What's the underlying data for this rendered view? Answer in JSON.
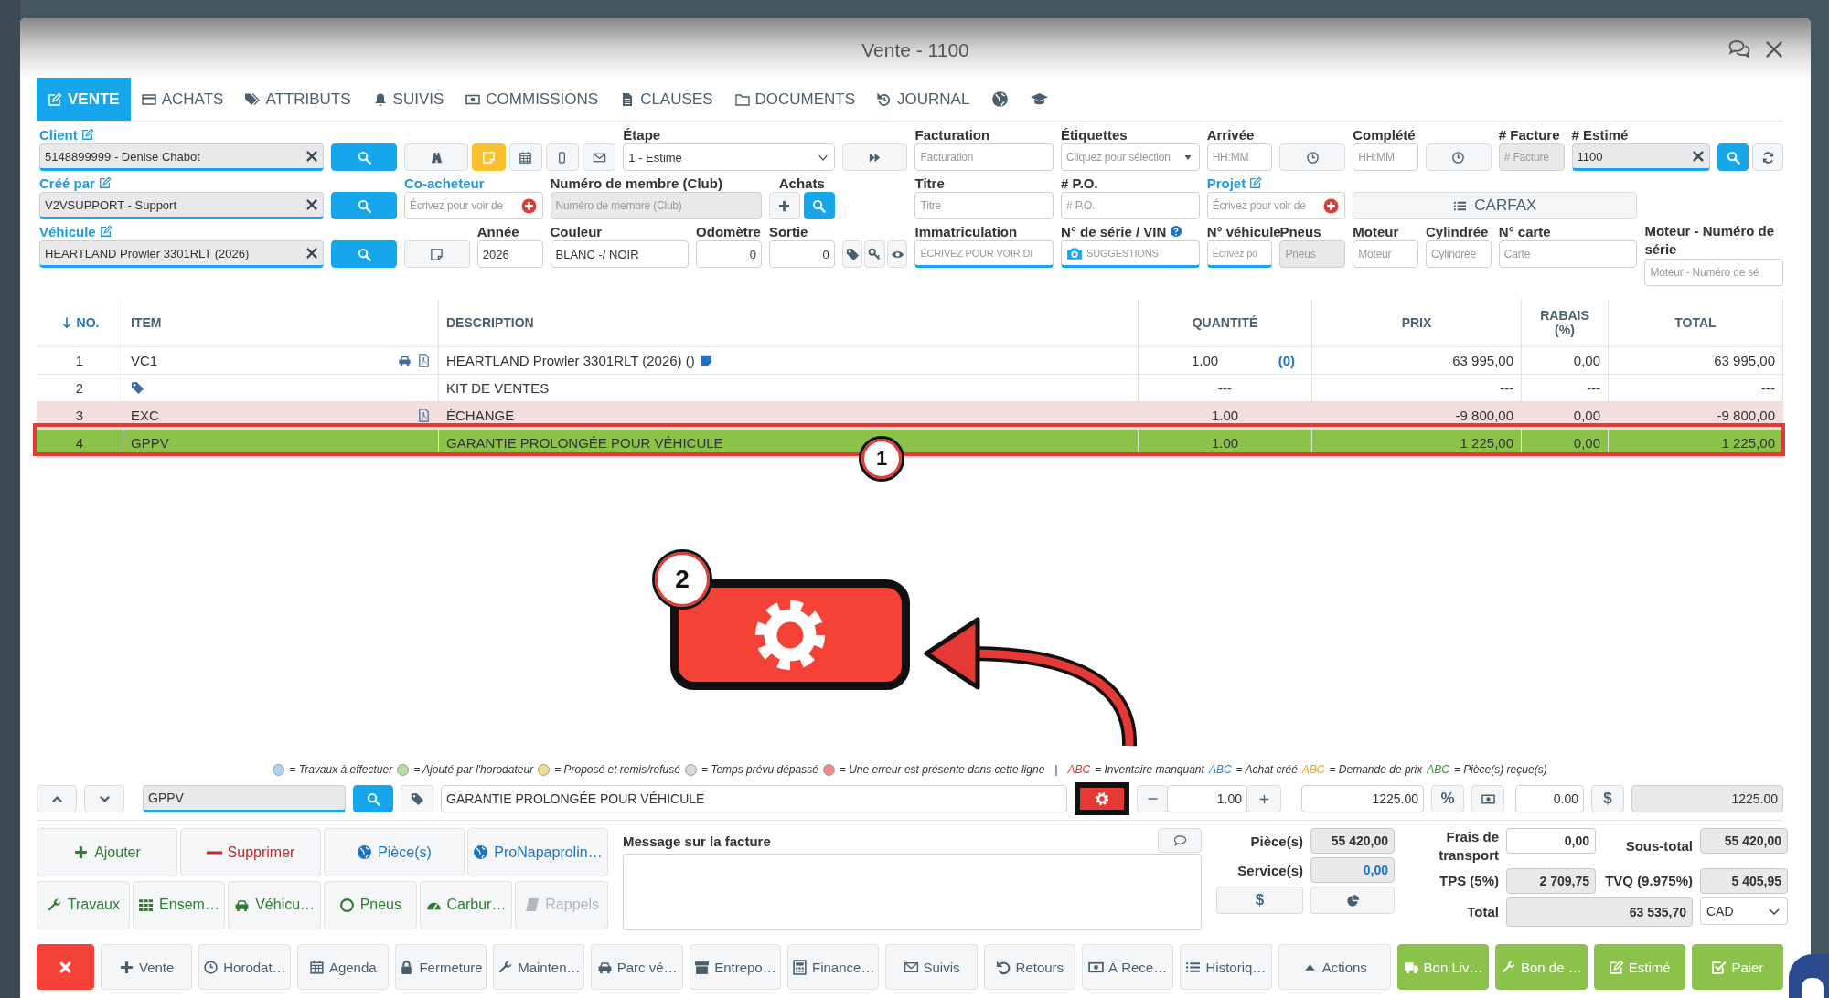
{
  "window": {
    "title": "Vente - 1100"
  },
  "tabs": [
    {
      "label": "VENTE",
      "selected": true
    },
    {
      "label": "ACHATS",
      "selected": false
    },
    {
      "label": "ATTRIBUTS",
      "selected": false
    },
    {
      "label": "SUIVIS",
      "selected": false
    },
    {
      "label": "COMMISSIONS",
      "selected": false
    },
    {
      "label": "CLAUSES",
      "selected": false
    },
    {
      "label": "DOCUMENTS",
      "selected": false
    },
    {
      "label": "JOURNAL",
      "selected": false
    }
  ],
  "form": {
    "fields": [
      {
        "kind": "lookup",
        "label": "Client",
        "link": true,
        "edit_icon": true,
        "value": "5148899999 - Denise Chabot"
      },
      {
        "kind": "search"
      },
      {
        "kind": "tools",
        "note": true
      },
      {
        "kind": "select",
        "label": "Étape",
        "link": false,
        "value": "1 - Estimé"
      },
      {
        "kind": "forward"
      },
      {
        "kind": "input",
        "label": "Facturation",
        "link": false,
        "placeholder": "Facturation"
      },
      {
        "kind": "select",
        "label": "Étiquettes",
        "link": false,
        "placeholder": "Cliquez pour sélection"
      },
      {
        "kind": "input",
        "label": "Arrivée",
        "link": false,
        "placeholder": "HH:MM"
      },
      {
        "kind": "clock"
      },
      {
        "kind": "input",
        "label": "Complété",
        "link": false,
        "placeholder": "HH:MM"
      },
      {
        "kind": "clock"
      },
      {
        "kind": "readonly",
        "label": "# Facture",
        "link": false,
        "placeholder": "# Facture"
      },
      {
        "kind": "lookup",
        "label": "# Estimé",
        "link": false,
        "value": "1100"
      },
      {
        "kind": "search-refresh"
      },
      {
        "kind": "lookup",
        "label": "Créé par",
        "link": true,
        "edit_icon": true,
        "value": "V2VSUPPORT - Support"
      },
      {
        "kind": "search"
      },
      {
        "kind": "add",
        "label": "Co-acheteur",
        "link": true,
        "placeholder": "Écrivez pour voir de"
      },
      {
        "kind": "readonly",
        "label": "Numéro de membre (Club)",
        "link": false,
        "placeholder": "Numéro de membre (Club)"
      },
      {
        "kind": "plus-search",
        "label": "Achats",
        "link": false
      },
      {
        "kind": "blank"
      },
      {
        "kind": "input",
        "label": "Titre",
        "link": false,
        "placeholder": "Titre"
      },
      {
        "kind": "input",
        "label": "# P.O.",
        "link": false,
        "placeholder": "# P.O."
      },
      {
        "kind": "add",
        "label": "Projet",
        "link": true,
        "edit_icon": true,
        "placeholder": "Écrivez pour voir de"
      },
      {
        "kind": "carfax",
        "text": "CARFAX"
      },
      {
        "kind": "blank"
      },
      {
        "kind": "lookup",
        "label": "Véhicule",
        "link": true,
        "edit_icon": true,
        "value": "HEARTLAND Prowler 3301RLT (2026)"
      },
      {
        "kind": "search"
      },
      {
        "kind": "note"
      },
      {
        "kind": "input",
        "label": "Année",
        "link": false,
        "value": "2026"
      },
      {
        "kind": "input",
        "label": "Couleur",
        "link": false,
        "value": "BLANC -/ NOIR"
      },
      {
        "kind": "number",
        "label": "Odomètre",
        "link": false,
        "value": "0"
      },
      {
        "kind": "number",
        "label": "Sortie",
        "link": false,
        "value": "0"
      },
      {
        "kind": "tags"
      },
      {
        "kind": "autocomplete",
        "label": "Immatriculation",
        "link": false,
        "placeholder": "ÉCRIVEZ POUR VOIR DI"
      },
      {
        "kind": "vin",
        "label": "N° de série / VIN",
        "link": false,
        "placeholder": "SUGGESTIONS"
      },
      {
        "kind": "autocomplete",
        "label": "N° véhicule",
        "link": false,
        "placeholder": "Écrivez po"
      },
      {
        "kind": "readonly",
        "label": "Pneus",
        "link": false,
        "placeholder": "Pneus"
      },
      {
        "kind": "input",
        "label": "Moteur",
        "link": false,
        "placeholder": "Moteur"
      },
      {
        "kind": "input",
        "label": "Cylindrée",
        "link": false,
        "placeholder": "Cylindrée"
      },
      {
        "kind": "input",
        "label": "N° carte",
        "link": false,
        "placeholder": "Carte"
      },
      {
        "kind": "input",
        "label": "Moteur - Numéro de série",
        "link": false,
        "placeholder": "Moteur - Numéro de sé"
      }
    ]
  },
  "table": {
    "columns": [
      {
        "label": "NO.",
        "sorted": true
      },
      {
        "label": "ITEM",
        "sorted": false
      },
      {
        "label": "DESCRIPTION",
        "sorted": false
      },
      {
        "label": "QUANTITÉ",
        "sorted": false
      },
      {
        "label": "PRIX",
        "sorted": false
      },
      {
        "label": "RABAIS (%)",
        "sorted": false
      },
      {
        "label": "TOTAL",
        "sorted": false
      }
    ],
    "rows": [
      {
        "no": "1",
        "item": "VC1",
        "item_icons": [
          {
            "kind": "car"
          },
          {
            "kind": "pdf"
          }
        ],
        "description": "HEARTLAND Prowler 3301RLT (2026) ()",
        "note": true,
        "quantity": "1.00",
        "count": "(0)",
        "price": "63 995,00",
        "discount": "0,00",
        "total": "63 995,00",
        "selected": false,
        "error": false
      },
      {
        "no": "2",
        "item_icons": [
          {
            "kind": "tag"
          }
        ],
        "description": "KIT DE VENTES",
        "note": false,
        "quantity": "---",
        "price": "---",
        "discount": "---",
        "total": "---",
        "selected": false,
        "error": false
      },
      {
        "no": "3",
        "item": "EXC",
        "item_icons": [
          {
            "kind": "pdf"
          }
        ],
        "description": "ÉCHANGE",
        "note": false,
        "quantity": "1.00",
        "price": "-9 800,00",
        "discount": "0,00",
        "total": "-9 800,00",
        "selected": false,
        "error": true
      },
      {
        "no": "4",
        "item": "GPPV",
        "item_icons": [],
        "description": "GARANTIE PROLONGÉE POUR VÉHICULE",
        "note": false,
        "quantity": "1.00",
        "price": "1 225,00",
        "discount": "0,00",
        "total": "1 225,00",
        "selected": true,
        "error": false
      }
    ]
  },
  "annotations": [
    {
      "label": "1"
    },
    {
      "label": "2"
    }
  ],
  "legend": {
    "dots": [
      {
        "color": "#a9d4f5",
        "text": "= Travaux à effectuer"
      },
      {
        "color": "#b9dea2",
        "text": "= Ajouté par l'horodateur"
      },
      {
        "color": "#f5db8e",
        "text": "= Proposé et remis/refusé"
      },
      {
        "color": "#dadada",
        "text": "= Temps prévu dépassé"
      },
      {
        "color": "#f08a8a",
        "text": "= Une erreur est présente dans cette ligne"
      }
    ],
    "separator": "|",
    "codes": [
      {
        "code": "ABC",
        "color": "#d9362b",
        "text": "= Inventaire manquant"
      },
      {
        "code": "ABC",
        "color": "#2f7fd0",
        "text": "= Achat créé"
      },
      {
        "code": "ABC",
        "color": "#f0a30a",
        "text": "= Demande de prix"
      },
      {
        "code": "ABC",
        "color": "#3c8c3c",
        "text": "= Pièce(s) reçue(s)"
      }
    ]
  },
  "line_editor": {
    "item": "GPPV",
    "description": "GARANTIE PROLONGÉE POUR VÉHICULE",
    "quantity": "1.00",
    "price": "1225.00",
    "percent_symbol": "%",
    "discount": "0.00",
    "dollar_symbol": "$",
    "total": "1225.00"
  },
  "actions": [
    {
      "label": "Ajouter",
      "kind": "positive",
      "disabled": false
    },
    {
      "label": "Supprimer",
      "kind": "danger",
      "disabled": false
    },
    {
      "label": "Pièce(s)",
      "kind": "info",
      "disabled": false
    },
    {
      "label": "ProNapaprolin…",
      "kind": "info",
      "disabled": false
    },
    {
      "label": "Travaux",
      "kind": "positive",
      "disabled": false
    },
    {
      "label": "Ensem…",
      "kind": "positive",
      "disabled": false
    },
    {
      "label": "Véhicu…",
      "kind": "positive",
      "disabled": false
    },
    {
      "label": "Pneus",
      "kind": "positive",
      "disabled": false
    },
    {
      "label": "Carbur…",
      "kind": "positive",
      "disabled": false
    },
    {
      "label": "Rappels",
      "kind": "positive",
      "disabled": true
    }
  ],
  "message": {
    "label": "Message sur la facture"
  },
  "summary": {
    "parts_label": "Pièce(s)",
    "parts": "55 420,00",
    "services_label": "Service(s)",
    "services": "0,00",
    "dollar_symbol": "$",
    "shipping_label": "Frais de transport",
    "shipping": "0,00",
    "subtotal_label": "Sous-total",
    "subtotal": "55 420,00",
    "tps_label": "TPS (5%)",
    "tps": "2 709,75",
    "tvq_label": "TVQ (9.975%)",
    "tvq": "5 405,95",
    "total_label": "Total",
    "total": "63 535,70",
    "currency": "CAD"
  },
  "toolbar": [
    {
      "kind": "close"
    },
    {
      "label": "Vente",
      "kind": "default"
    },
    {
      "label": "Horodat…",
      "kind": "default"
    },
    {
      "label": "Agenda",
      "kind": "default"
    },
    {
      "label": "Fermeture",
      "kind": "default"
    },
    {
      "label": "Mainten…",
      "kind": "default"
    },
    {
      "label": "Parc vé…",
      "kind": "default"
    },
    {
      "label": "Entrepo…",
      "kind": "default"
    },
    {
      "label": "Finance…",
      "kind": "default"
    },
    {
      "label": "Suivis",
      "kind": "default"
    },
    {
      "label": "Retours",
      "kind": "default"
    },
    {
      "label": "À Rece…",
      "kind": "default"
    },
    {
      "label": "Historiq…",
      "kind": "default"
    },
    {
      "label": "Actions",
      "kind": "default"
    },
    {
      "label": "Bon Liv…",
      "kind": "success"
    },
    {
      "label": "Bon de …",
      "kind": "success"
    },
    {
      "label": "Estimé",
      "kind": "success"
    },
    {
      "label": "Paier",
      "kind": "success"
    }
  ]
}
